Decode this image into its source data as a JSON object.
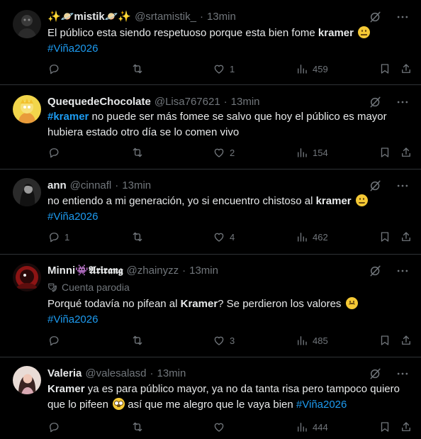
{
  "tweets": [
    {
      "name": "✨🪐mistik🪐✨",
      "handle": "@srtamistik_",
      "time": "13min",
      "text_plain": "El público esta siendo respetuoso porque esta bien fome ",
      "text_bold": "kramer",
      "hashtag": "#Viña2026",
      "replies": "",
      "retweets": "",
      "likes": "1",
      "views": "459"
    },
    {
      "name": "QuequedeChocolate",
      "handle": "@Lisa767621",
      "time": "13min",
      "hashtag_lead": "#kramer",
      "text_plain": " no puede ser más fomee se salvo que hoy el público es mayor hubiera estado otro día se lo comen vivo",
      "replies": "",
      "retweets": "",
      "likes": "2",
      "views": "154"
    },
    {
      "name": "ann",
      "handle": "@cinnafl",
      "time": "13min",
      "text_plain": "no entiendo a mi generación, yo si encuentro chistoso al ",
      "text_bold": "kramer",
      "hashtag": "#Viña2026",
      "replies": "1",
      "retweets": "",
      "likes": "4",
      "views": "462"
    },
    {
      "name": "Minni👾𝕬𝖗𝖎𝖗𝖆𝖓𝖌",
      "handle": "@zhainyzz",
      "time": "13min",
      "parody": "Cuenta parodia",
      "text_plain": "Porqué todavía no pifean al ",
      "text_bold": "Kramer",
      "text_after": "? Se perdieron los valores ",
      "hashtag": "#Viña2026",
      "replies": "",
      "retweets": "",
      "likes": "3",
      "views": "485"
    },
    {
      "name": "Valeria",
      "handle": "@valesalasd",
      "time": "13min",
      "text_bold": "Kramer",
      "text_plain": " ya es para público mayor, ya no da tanta risa pero tampoco quiero que lo pifeen ",
      "text_after": " así que me alegro que le vaya bien ",
      "hashtag": "#Viña2026",
      "replies": "",
      "retweets": "",
      "likes": "",
      "views": "444"
    }
  ],
  "sep": "·",
  "icons": [
    "reply-icon",
    "retweet-icon",
    "like-icon",
    "views-icon",
    "bookmark-icon",
    "share-icon",
    "grok-icon",
    "more-icon"
  ],
  "colors": {
    "background": "#000000",
    "text": "#e7e9ea",
    "muted": "#71767b",
    "link": "#1d9bf0",
    "divider": "#2f3336"
  }
}
